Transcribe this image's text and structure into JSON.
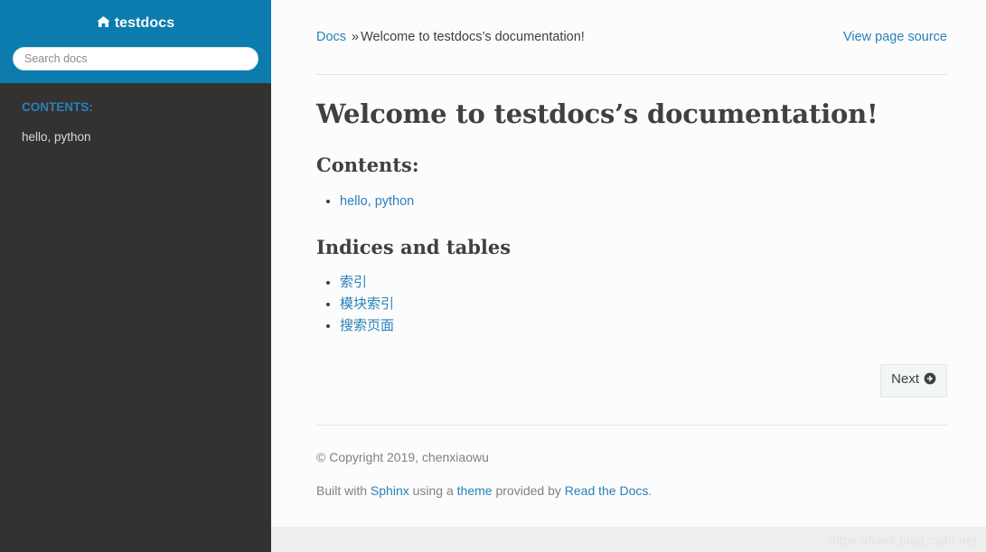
{
  "sidebar": {
    "brand": {
      "icon": "home-icon",
      "label": "testdocs"
    },
    "search": {
      "placeholder": "Search docs",
      "value": ""
    },
    "nav": {
      "caption": "CONTENTS:",
      "items": [
        {
          "label": "hello, python"
        }
      ]
    },
    "colors": {
      "header_bg": "#0b7cad",
      "body_bg": "#343131",
      "caption": "#2980b9",
      "item_text": "#d9d9d9"
    }
  },
  "main": {
    "breadcrumb": {
      "home_label": "Docs",
      "separator": "»",
      "current": "Welcome to testdocs’s documentation!"
    },
    "view_source_label": "View page source",
    "title": "Welcome to testdocs’s documentation!",
    "contents": {
      "heading": "Contents:",
      "items": [
        {
          "label": "hello, python"
        }
      ]
    },
    "indices": {
      "heading": "Indices and tables",
      "items": [
        {
          "label": "索引"
        },
        {
          "label": "模块索引"
        },
        {
          "label": "搜索页面"
        }
      ]
    },
    "next_button": {
      "label": "Next",
      "icon": "arrow-circle-right-icon"
    },
    "footer": {
      "copyright": "© Copyright 2019, chenxiaowu",
      "built_prefix": "Built with ",
      "sphinx_link": "Sphinx",
      "built_mid": " using a ",
      "theme_link": "theme",
      "built_mid2": " provided by ",
      "rtd_link": "Read the Docs",
      "built_suffix": "."
    },
    "colors": {
      "link": "#2980b9",
      "text": "#404040",
      "muted": "#808080",
      "page_bg": "#fcfcfc",
      "strip_bg": "#edeeee"
    }
  },
  "watermark": "https://five3.blog.csdn.net"
}
